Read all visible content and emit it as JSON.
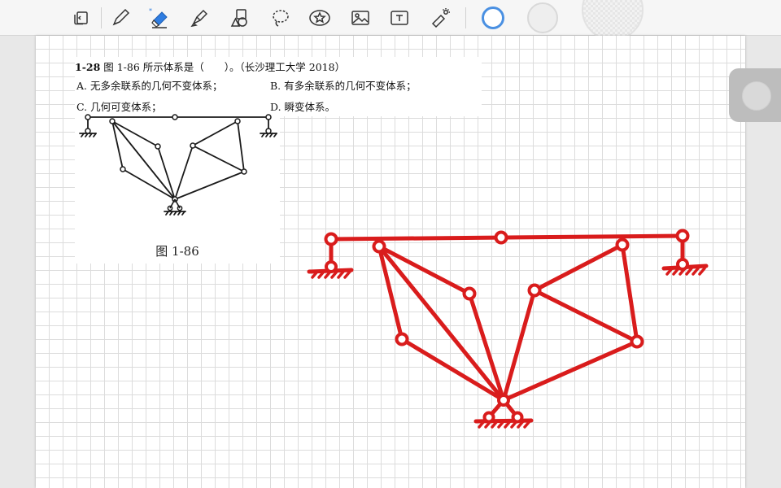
{
  "toolbar": {
    "tools": [
      {
        "name": "page-sidebar-icon",
        "active": false
      },
      {
        "name": "pen-icon",
        "active": false
      },
      {
        "name": "eraser-icon",
        "active": true
      },
      {
        "name": "highlighter-icon",
        "active": false
      },
      {
        "name": "shapes-icon",
        "active": false
      },
      {
        "name": "lasso-icon",
        "active": false
      },
      {
        "name": "sticker-icon",
        "active": false
      },
      {
        "name": "image-icon",
        "active": false
      },
      {
        "name": "text-box-icon",
        "active": false
      },
      {
        "name": "laser-pointer-icon",
        "active": false
      }
    ],
    "colors": {
      "selected_ring": "#4a90e2",
      "swatch_light": "#eeeeee",
      "swatch_pattern": "#f2f2f2"
    }
  },
  "problem": {
    "number": "1-28",
    "stem": " 图 1-86 所示体系是（　　）。（长沙理工大学 2018）",
    "options": [
      {
        "key": "A.",
        "text": "无多余联系的几何不变体系；"
      },
      {
        "key": "B.",
        "text": "有多余联系的几何不变体系；"
      },
      {
        "key": "C.",
        "text": "几何可变体系；"
      },
      {
        "key": "D.",
        "text": "瞬变体系。"
      }
    ],
    "figure_caption": "图 1-86"
  },
  "drawing": {
    "ink_color": "#d91c1c",
    "figure_color": "#1a1a1a"
  }
}
